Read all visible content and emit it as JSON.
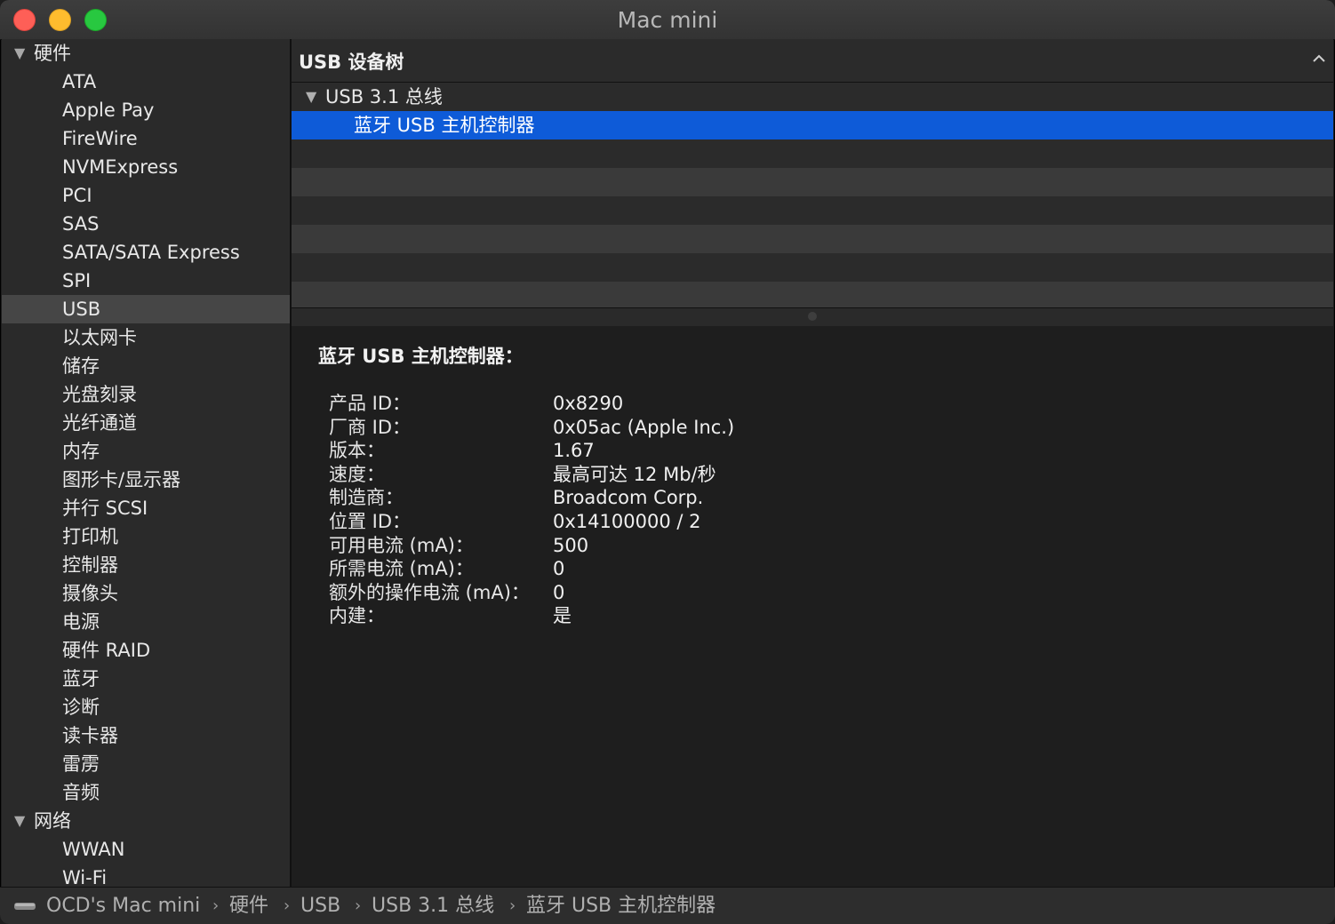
{
  "window": {
    "title": "Mac mini"
  },
  "sidebar": {
    "groups": [
      {
        "label": "硬件",
        "items": [
          "ATA",
          "Apple Pay",
          "FireWire",
          "NVMExpress",
          "PCI",
          "SAS",
          "SATA/SATA Express",
          "SPI",
          "USB",
          "以太网卡",
          "储存",
          "光盘刻录",
          "光纤通道",
          "内存",
          "图形卡/显示器",
          "并行 SCSI",
          "打印机",
          "控制器",
          "摄像头",
          "电源",
          "硬件 RAID",
          "蓝牙",
          "诊断",
          "读卡器",
          "雷雳",
          "音频"
        ]
      },
      {
        "label": "网络",
        "items": [
          "WWAN",
          "Wi-Fi"
        ]
      }
    ],
    "selected": "USB"
  },
  "tree": {
    "header": "USB 设备树",
    "rows": [
      {
        "label": "USB 3.1 总线",
        "expanded": true
      },
      {
        "label": "蓝牙 USB 主机控制器",
        "selected": true
      }
    ]
  },
  "detail": {
    "title": "蓝牙 USB 主机控制器：",
    "properties": [
      {
        "key": "产品 ID：",
        "value": "0x8290"
      },
      {
        "key": "厂商 ID：",
        "value": "0x05ac (Apple Inc.)"
      },
      {
        "key": "版本：",
        "value": "1.67"
      },
      {
        "key": "速度：",
        "value": "最高可达 12 Mb/秒"
      },
      {
        "key": "制造商：",
        "value": "Broadcom Corp."
      },
      {
        "key": "位置 ID：",
        "value": "0x14100000 / 2"
      },
      {
        "key": "可用电流 (mA)：",
        "value": "500"
      },
      {
        "key": "所需电流 (mA)：",
        "value": "0"
      },
      {
        "key": "额外的操作电流 (mA)：",
        "value": "0"
      },
      {
        "key": "内建：",
        "value": "是"
      }
    ]
  },
  "pathbar": {
    "items": [
      "OCD's Mac mini",
      "硬件",
      "USB",
      "USB 3.1 总线",
      "蓝牙 USB 主机控制器"
    ]
  },
  "colors": {
    "selection": "#0e5bd8",
    "close": "#fe5f57",
    "minimize": "#febc2e",
    "maximize": "#28c840"
  }
}
